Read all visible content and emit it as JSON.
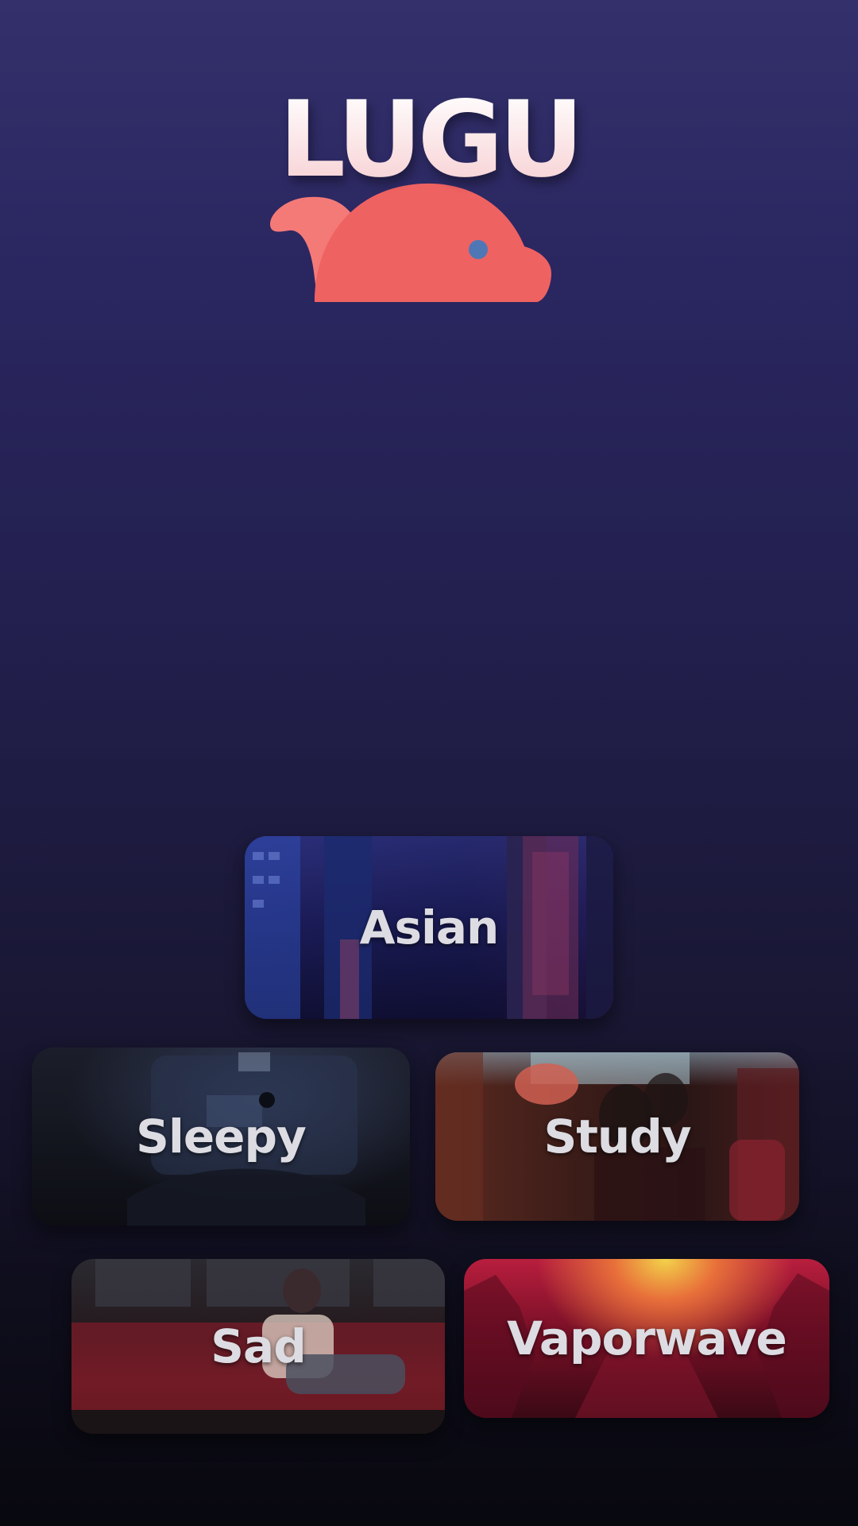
{
  "app": {
    "logo_text": "LUGU",
    "logo_colors": {
      "text": "#fde8ea",
      "creature": "#ef6262",
      "eye": "#4f77b5"
    }
  },
  "moods": [
    {
      "id": "asian",
      "label": "Asian"
    },
    {
      "id": "sleepy",
      "label": "Sleepy"
    },
    {
      "id": "study",
      "label": "Study"
    },
    {
      "id": "sad",
      "label": "Sad"
    },
    {
      "id": "vaporwave",
      "label": "Vaporwave"
    }
  ]
}
